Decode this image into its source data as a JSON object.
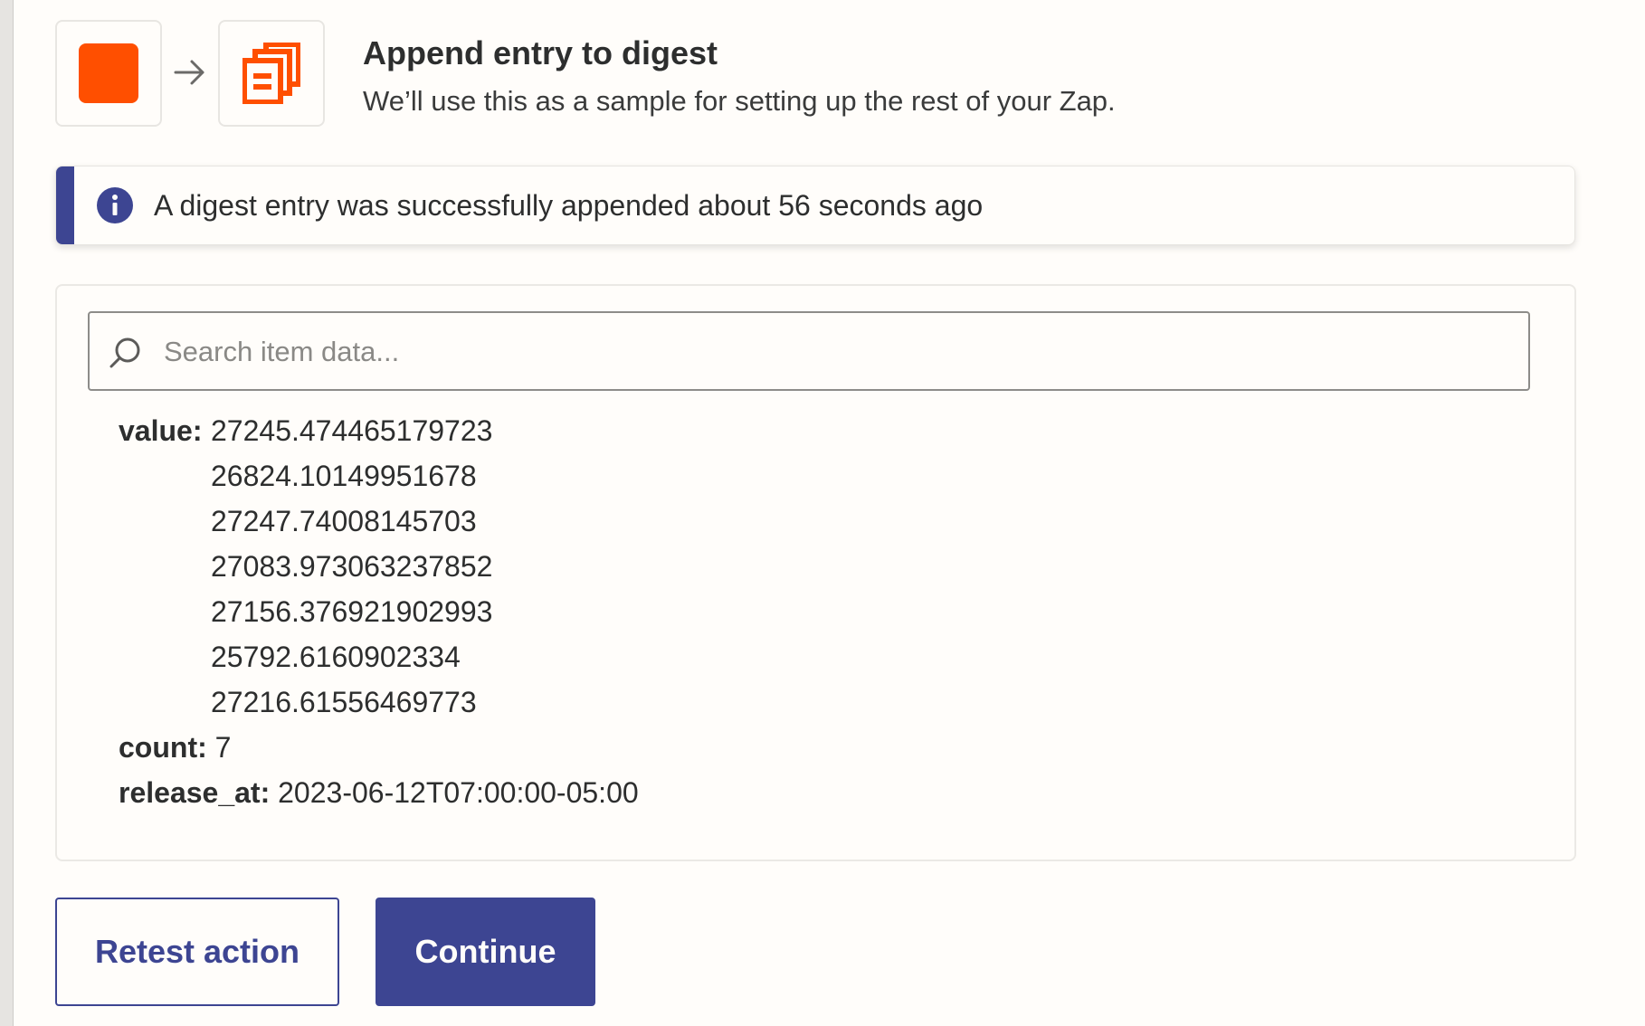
{
  "header": {
    "title": "Append entry to digest",
    "subtitle": "We’ll use this as a sample for setting up the rest of your Zap."
  },
  "apps": {
    "trigger_color": "#ff4f00",
    "action_icon": "digest-icon",
    "action_color": "#ff4f00"
  },
  "alert": {
    "icon": "info-icon",
    "text": "A digest entry was successfully appended about 56 seconds ago",
    "accent": "#3d4592"
  },
  "search": {
    "placeholder": "Search item data...",
    "value": ""
  },
  "item_data": {
    "value_label": "value:",
    "values": [
      "27245.474465179723",
      "26824.10149951678",
      "27247.74008145703",
      "27083.973063237852",
      "27156.376921902993",
      "25792.6160902334",
      "27216.61556469773"
    ],
    "count_label": "count:",
    "count": "7",
    "release_label": "release_at:",
    "release_at": "2023-06-12T07:00:00-05:00"
  },
  "buttons": {
    "retest": "Retest action",
    "continue": "Continue"
  }
}
